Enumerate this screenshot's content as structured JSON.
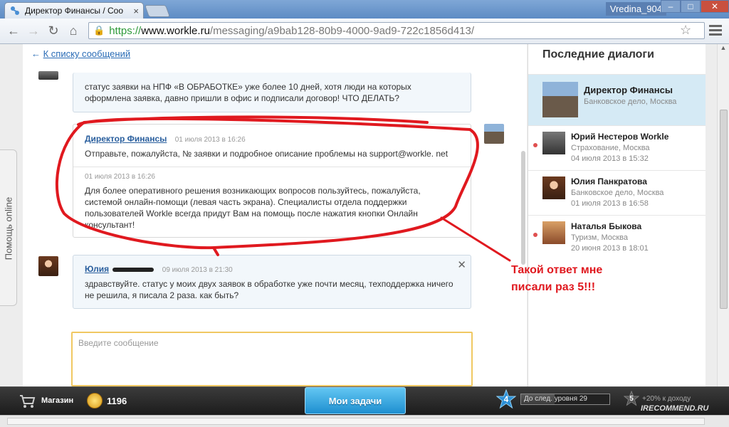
{
  "browser": {
    "tab_title": "Директор Финансы / Соо",
    "tab_close": "×",
    "user": "Vredina_904",
    "window_controls": [
      "–",
      "□",
      "✕"
    ],
    "nav": {
      "back": "←",
      "forward": "→",
      "reload": "↻",
      "home": "⌂"
    },
    "url": {
      "scheme": "https://",
      "host": "www.workle.ru",
      "path": "/messaging/a9bab128-80b9-4000-9ad9-722c1856d413/"
    }
  },
  "help_tab": "Помощь online",
  "back_link": {
    "arrow": "←",
    "label": "К списку сообщений"
  },
  "messages": [
    {
      "sender": "",
      "time": "",
      "text": "статус заявки на НПФ «В ОБРАБОТКЕ» уже более 10 дней, хотя люди на которых оформлена заявка, давно пришли в офис и подписали договор! ЧТО ДЕЛАТЬ?"
    },
    {
      "sender": "Директор Финансы",
      "time": "01 июля 2013 в 16:26",
      "text": "Отправьте, пожалуйста, № заявки и подробное описание проблемы на support@workle. net",
      "time2": "01 июля 2013 в 16:26",
      "text2": "Для более оперативного решения возникающих вопросов пользуйтесь, пожалуйста, системой онлайн-помощи (левая часть экрана). Специалисты отдела поддержки пользователей Workle всегда придут Вам на помощь после нажатия кнопки Онлайн консультант!"
    },
    {
      "sender": "Юлия",
      "time": "09 июля 2013 в 21:30",
      "close": "✕",
      "text": "здравствуйте. статус у моих двух заявок в обработке уже почти месяц, техподдержка ничего не решила, я писала 2 раза. как быть?"
    }
  ],
  "compose": {
    "placeholder": "Введите сообщение"
  },
  "sidebar": {
    "title": "Последние диалоги",
    "dialogs": [
      {
        "name": "Директор Финансы",
        "sub": "Банковское дело, Москва",
        "date": "",
        "active": true,
        "unread": false
      },
      {
        "name": "Юрий Нестеров Workle",
        "sub": "Страхование, Москва",
        "date": "04 июля 2013 в 15:32",
        "active": false,
        "unread": true
      },
      {
        "name": "Юлия Панкратова",
        "sub": "Банковское дело, Москва",
        "date": "01 июля 2013 в 16:58",
        "active": false,
        "unread": false
      },
      {
        "name": "Наталья Быкова",
        "sub": "Туризм, Москва",
        "date": "20 июня 2013 в 18:01",
        "active": false,
        "unread": true
      }
    ]
  },
  "annotation": {
    "line1": "Такой ответ мне",
    "line2": "писали раз 5!!!",
    "color": "#e0191f"
  },
  "gamebar": {
    "shop": "Магазин",
    "coins": "1196",
    "tasks": "Мои задачи",
    "level": "4",
    "level_label": "До след. уровня 29",
    "level_progress": 0.38,
    "bonus_level": "5",
    "bonus_label": "+20% к доходу"
  },
  "watermark": "IRECOMMEND.RU"
}
